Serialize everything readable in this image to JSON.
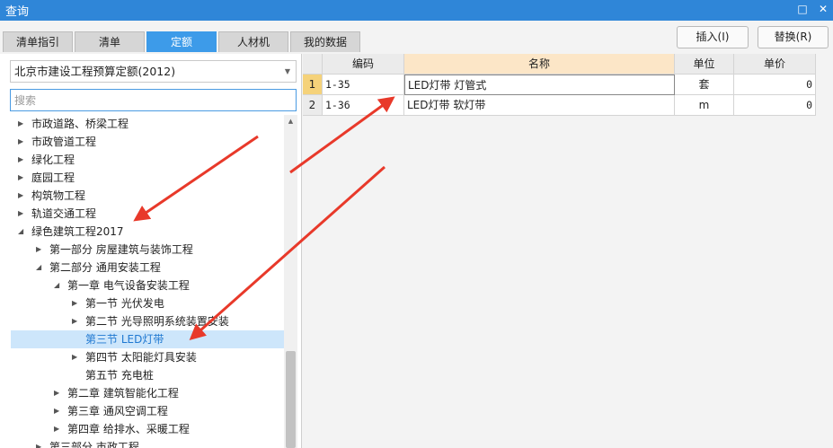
{
  "window": {
    "title": "查询",
    "restore_glyph": "□",
    "close_glyph": "✕"
  },
  "tabs": [
    {
      "label": "清单指引",
      "active": false
    },
    {
      "label": "清单",
      "active": false
    },
    {
      "label": "定额",
      "active": true
    },
    {
      "label": "人材机",
      "active": false
    },
    {
      "label": "我的数据",
      "active": false
    }
  ],
  "toolbar": {
    "insert_label": "插入(I)",
    "replace_label": "替换(R)"
  },
  "left": {
    "dropdown_value": "北京市建设工程预算定额(2012)",
    "search_placeholder": "搜索",
    "tree": [
      {
        "label": "市政道路、桥梁工程",
        "toggle": "▶",
        "selected": false
      },
      {
        "label": "市政管道工程",
        "toggle": "▶",
        "selected": false
      },
      {
        "label": "绿化工程",
        "toggle": "▶",
        "selected": false
      },
      {
        "label": "庭园工程",
        "toggle": "▶",
        "selected": false
      },
      {
        "label": "构筑物工程",
        "toggle": "▶",
        "selected": false
      },
      {
        "label": "轨道交通工程",
        "toggle": "▶",
        "selected": false
      },
      {
        "label": "绿色建筑工程2017",
        "toggle": "◢",
        "selected": false
      },
      {
        "label": "第一部分 房屋建筑与装饰工程",
        "toggle": "▶",
        "selected": false
      },
      {
        "label": "第二部分 通用安装工程",
        "toggle": "◢",
        "selected": false
      },
      {
        "label": "第一章 电气设备安装工程",
        "toggle": "◢",
        "selected": false
      },
      {
        "label": "第一节 光伏发电",
        "toggle": "▶",
        "selected": false
      },
      {
        "label": "第二节 光导照明系统装置安装",
        "toggle": "▶",
        "selected": false
      },
      {
        "label": "第三节 LED灯带",
        "toggle": "",
        "selected": true
      },
      {
        "label": "第四节 太阳能灯具安装",
        "toggle": "▶",
        "selected": false
      },
      {
        "label": "第五节 充电桩",
        "toggle": "",
        "selected": false
      },
      {
        "label": "第二章 建筑智能化工程",
        "toggle": "▶",
        "selected": false
      },
      {
        "label": "第三章 通风空调工程",
        "toggle": "▶",
        "selected": false
      },
      {
        "label": "第四章 给排水、采暖工程",
        "toggle": "▶",
        "selected": false
      },
      {
        "label": "第三部分 市政工程",
        "toggle": "▶",
        "selected": false
      }
    ]
  },
  "table": {
    "headers": {
      "code": "编码",
      "name": "名称",
      "unit": "单位",
      "price": "单价"
    },
    "rows": [
      {
        "num": "1",
        "code": "1-35",
        "name": "LED灯带 灯管式",
        "unit": "套",
        "price": "0"
      },
      {
        "num": "2",
        "code": "1-36",
        "name": "LED灯带 软灯带",
        "unit": "m",
        "price": "0"
      }
    ]
  },
  "colors": {
    "accent": "#3d9be9",
    "titlebar": "#2f86d8",
    "annotation": "#e8392a",
    "selection": "#cde6fb"
  }
}
